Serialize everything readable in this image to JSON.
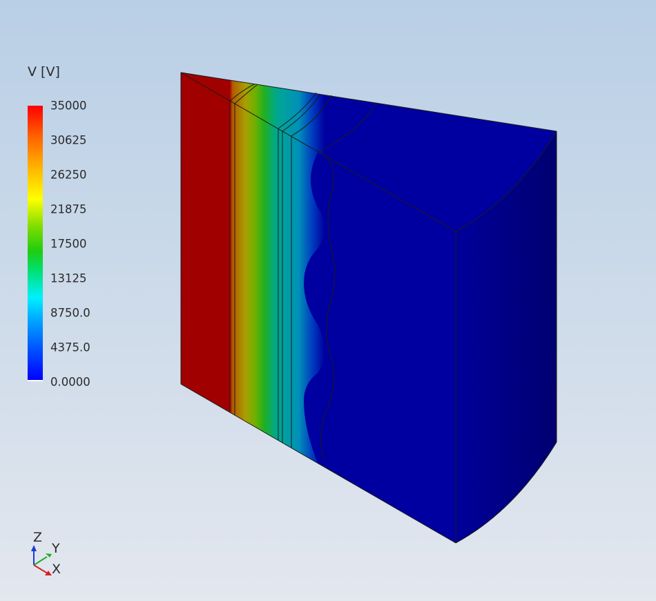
{
  "legend": {
    "title": "V [V]",
    "ticks": [
      "35000",
      "30625",
      "26250",
      "21875",
      "17500",
      "13125",
      "8750.0",
      "4375.0",
      "0.0000"
    ],
    "min": 0,
    "max": 35000,
    "colormap": "rainbow",
    "colors": [
      "#ff0000",
      "#ff6000",
      "#ffb000",
      "#ffff00",
      "#80dd00",
      "#20cc10",
      "#00e070",
      "#00f0ff",
      "#00a8ff",
      "#0050ff",
      "#0000ff"
    ]
  },
  "triad": {
    "z": "Z",
    "y": "Y",
    "x": "X"
  },
  "model": {
    "color_high": "#a00000",
    "color_low": "#0000a0",
    "color_side": "#00007a"
  }
}
